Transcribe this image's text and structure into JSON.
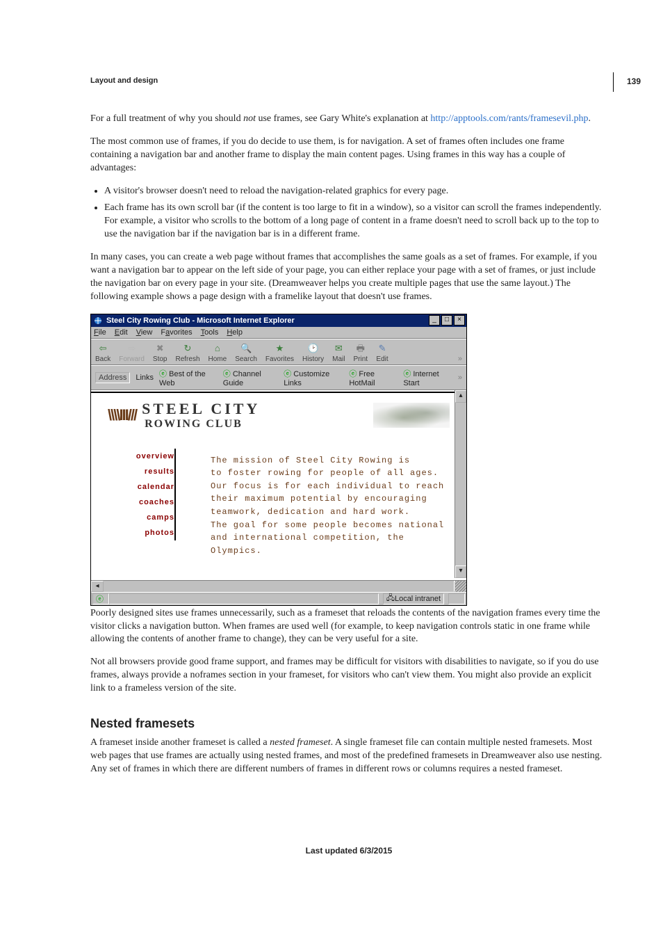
{
  "page_number": "139",
  "section_tag": "Layout and design",
  "para1_a": "For a full treatment of why you should ",
  "para1_b_i": "not",
  "para1_c": " use frames, see Gary White's explanation at ",
  "para1_link": "http://apptools.com/rants/framesevil.php",
  "para1_d": ".",
  "para2": "The most common use of frames, if you do decide to use them, is for navigation. A set of frames often includes one frame containing a navigation bar and another frame to display the main content pages. Using frames in this way has a couple of advantages:",
  "bullet1": "A visitor's browser doesn't need to reload the navigation-related graphics for every page.",
  "bullet2": "Each frame has its own scroll bar (if the content is too large to fit in a window), so a visitor can scroll the frames independently. For example, a visitor who scrolls to the bottom of a long page of content in a frame doesn't need to scroll back up to the top to use the navigation bar if the navigation bar is in a different frame.",
  "para3": "In many cases, you can create a web page without frames that accomplishes the same goals as a set of frames. For example, if you want a navigation bar to appear on the left side of your page, you can either replace your page with a set of frames, or just include the navigation bar on every page in your site. (Dreamweaver helps you create multiple pages that use the same layout.) The following example shows a page design with a framelike layout that doesn't use frames.",
  "para4": "Poorly designed sites use frames unnecessarily, such as a frameset that reloads the contents of the navigation frames every time the visitor clicks a navigation button. When frames are used well (for example, to keep navigation controls static in one frame while allowing the contents of another frame to change), they can be very useful for a site.",
  "para5": "Not all browsers provide good frame support, and frames may be difficult for visitors with disabilities to navigate, so if you do use frames, always provide a noframes section in your frameset, for visitors who can't view them. You might also provide an explicit link to a frameless version of the site.",
  "h2_nested": "Nested framesets",
  "para6_a": "A frameset inside another frameset is called a ",
  "para6_b_i": "nested frameset",
  "para6_c": ". A single frameset file can contain multiple nested framesets. Most web pages that use frames are actually using nested frames, and most of the predefined framesets in Dreamweaver also use nesting. Any set of frames in which there are different numbers of frames in different rows or columns requires a nested frameset.",
  "last_updated": "Last updated 6/3/2015",
  "ie": {
    "title": "Steel City Rowing Club - Microsoft Internet Explorer",
    "min": "_",
    "max": "□",
    "close": "×",
    "menu": {
      "file": "File",
      "edit": "Edit",
      "view": "View",
      "fav": "Favorites",
      "tools": "Tools",
      "help": "Help"
    },
    "tb": {
      "back": "Back",
      "forward": "Forward",
      "stop": "Stop",
      "refresh": "Refresh",
      "home": "Home",
      "search": "Search",
      "favorites": "Favorites",
      "history": "History",
      "mail": "Mail",
      "print": "Print",
      "editbtn": "Edit"
    },
    "addr": {
      "label": "Address",
      "linksLabel": "Links",
      "l1": "Best of the Web",
      "l2": "Channel Guide",
      "l3": "Customize Links",
      "l4": "Free HotMail",
      "l5": "Internet Start"
    },
    "page": {
      "brand1": "STEEL CITY",
      "brand2": "ROWING CLUB",
      "nav": [
        "overview",
        "results",
        "calendar",
        "coaches",
        "camps",
        "photos"
      ],
      "body": [
        "The mission of Steel City Rowing is",
        "to foster rowing for people of all ages.",
        "Our focus is for each individual to reach",
        "their maximum potential by encouraging",
        "teamwork, dedication and hard work.",
        "The goal for some people becomes national",
        "and international competition, the",
        "Olympics."
      ]
    },
    "status": "Local intranet"
  }
}
